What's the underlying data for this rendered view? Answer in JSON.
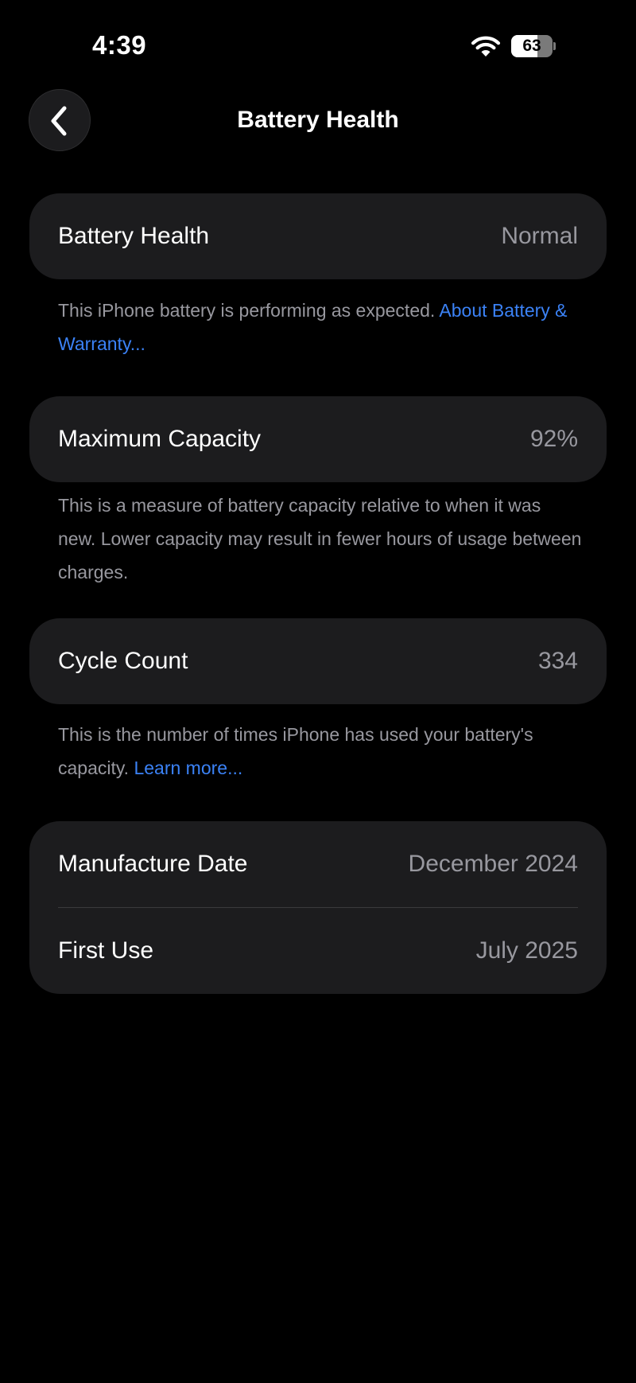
{
  "status_bar": {
    "time": "4:39",
    "battery_level": "63",
    "battery_fraction": 0.63
  },
  "header": {
    "title": "Battery Health",
    "back_icon": "chevron-left-icon"
  },
  "sections": {
    "health": {
      "label": "Battery Health",
      "value": "Normal",
      "caption": "This iPhone battery is performing as expected.",
      "link": "About Battery & Warranty..."
    },
    "capacity": {
      "label": "Maximum Capacity",
      "value": "92%",
      "caption": "This is a measure of battery capacity relative to when it was new. Lower capacity may result in fewer hours of usage between charges."
    },
    "cycle": {
      "label": "Cycle Count",
      "value": "334",
      "caption": "This is the number of times iPhone has used your battery's capacity.",
      "link": "Learn more..."
    },
    "dates": {
      "manufacture_label": "Manufacture Date",
      "manufacture_value": "December 2024",
      "first_use_label": "First Use",
      "first_use_value": "July 2025"
    }
  },
  "colors": {
    "background": "#000000",
    "card": "#1c1c1e",
    "secondary_text": "#98989f",
    "link": "#3b82f6"
  }
}
